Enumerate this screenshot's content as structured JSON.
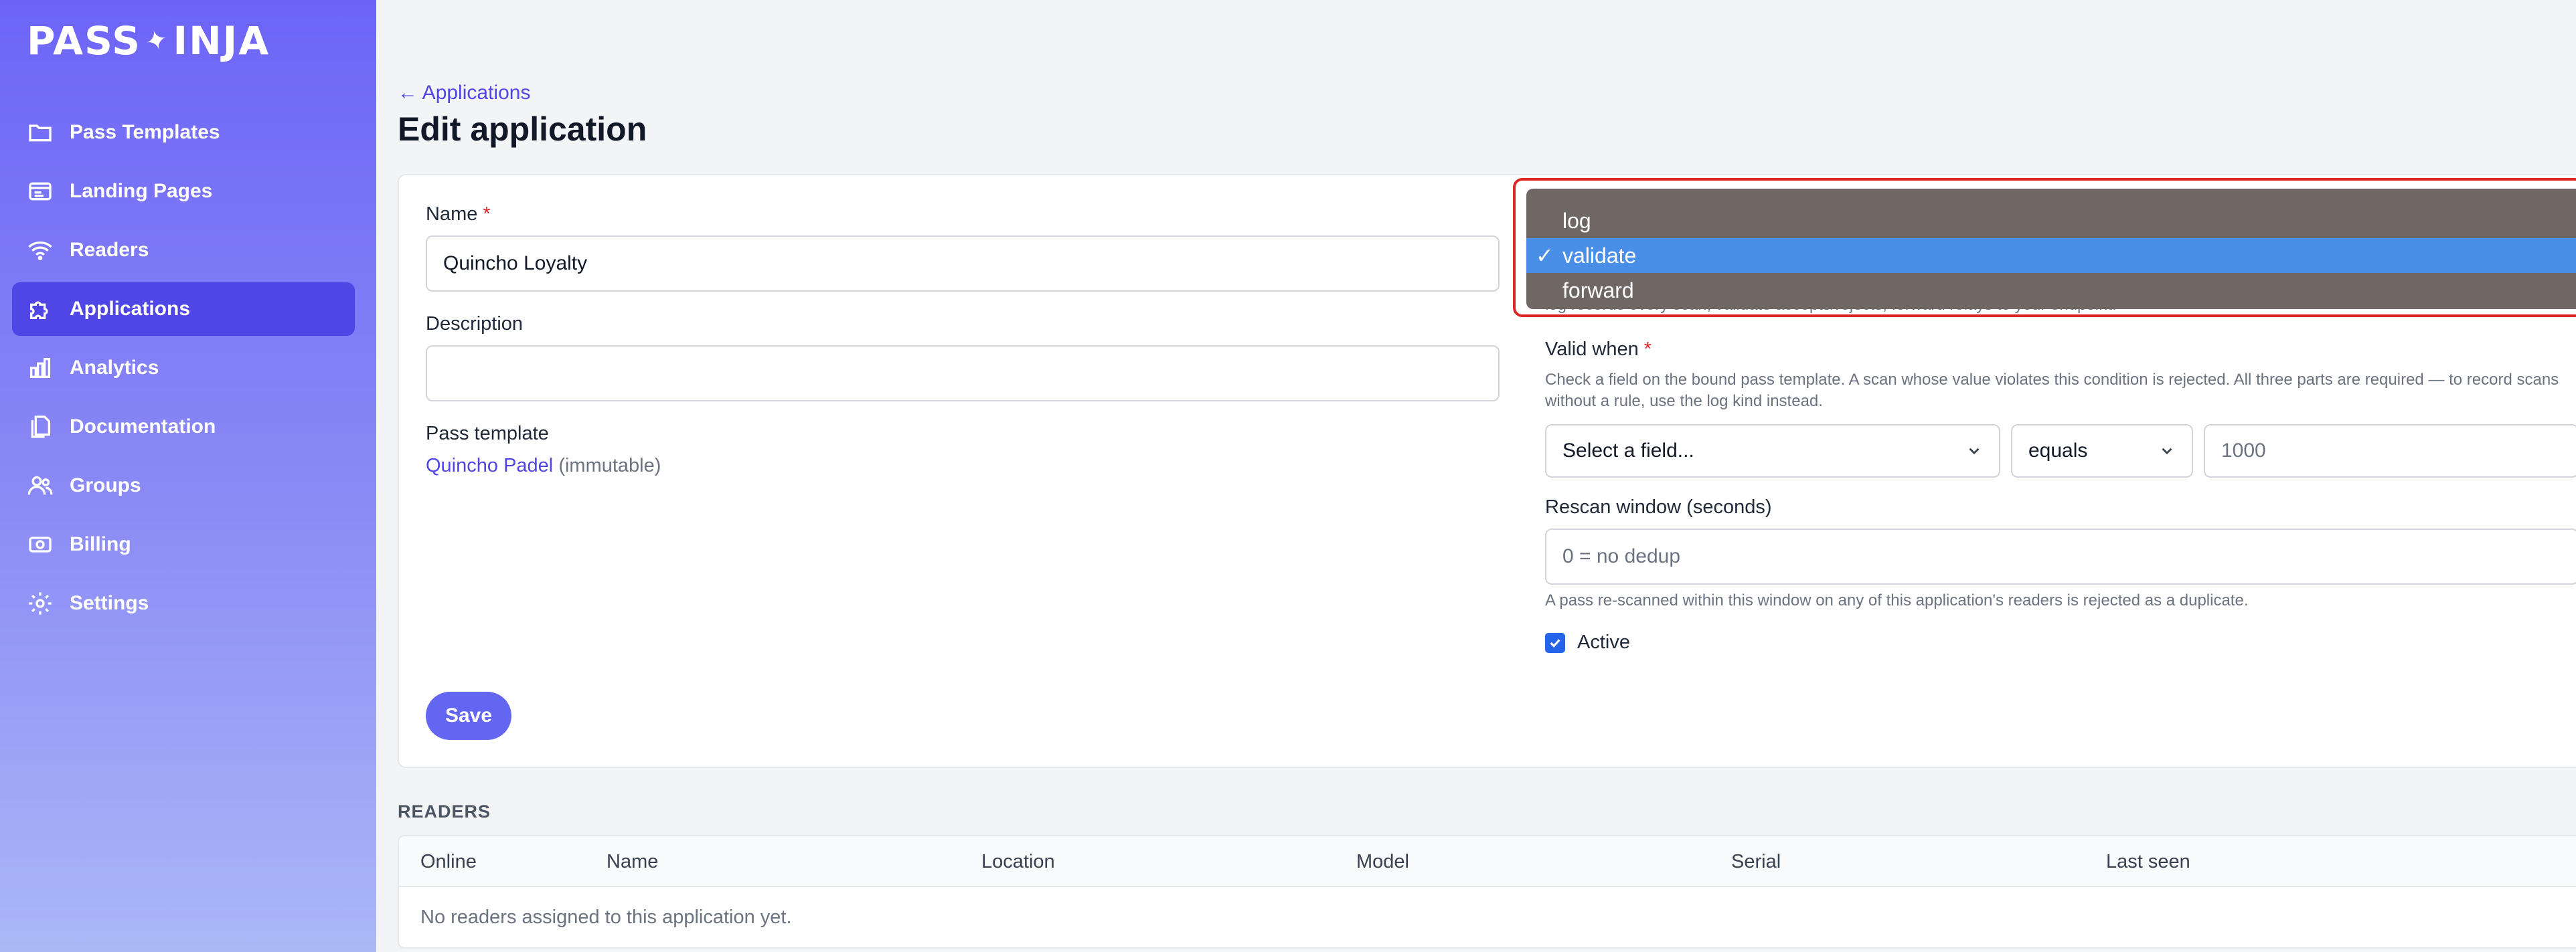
{
  "brand": {
    "logo_text_left": "PASS",
    "logo_text_right": "INJA"
  },
  "sidebar": {
    "items": [
      {
        "label": "Pass Templates",
        "icon": "folder-icon"
      },
      {
        "label": "Landing Pages",
        "icon": "browser-icon"
      },
      {
        "label": "Readers",
        "icon": "wifi-icon"
      },
      {
        "label": "Applications",
        "icon": "puzzle-icon",
        "active": true
      },
      {
        "label": "Analytics",
        "icon": "bar-chart-icon"
      },
      {
        "label": "Documentation",
        "icon": "documents-icon"
      },
      {
        "label": "Groups",
        "icon": "users-icon"
      },
      {
        "label": "Billing",
        "icon": "money-icon"
      },
      {
        "label": "Settings",
        "icon": "gear-icon"
      }
    ]
  },
  "header": {
    "back_link": "← Applications",
    "title": "Edit application"
  },
  "form": {
    "name_label": "Name",
    "required_mark": "*",
    "name_value": "Quincho Loyalty",
    "description_label": "Description",
    "description_value": "",
    "pass_template_label": "Pass template",
    "pass_template_link": "Quincho Padel",
    "pass_template_note": "(immutable)",
    "kind_help": "log records every scan; validate accepts/rejects; forward relays to your endpoint.",
    "valid_when_label": "Valid when",
    "valid_when_help": "Check a field on the bound pass template. A scan whose value violates this condition is rejected. All three parts are required — to record scans without a rule, use the log kind instead.",
    "field_select_value": "Select a field...",
    "operator_value": "equals",
    "condition_value": "1000",
    "rescan_label": "Rescan window (seconds)",
    "rescan_placeholder": "0 = no dedup",
    "rescan_help": "A pass re-scanned within this window on any of this application's readers is rejected as a duplicate.",
    "active_label": "Active",
    "active_checked": true,
    "save_label": "Save"
  },
  "kind_dropdown": {
    "options": [
      {
        "label": "log",
        "selected": false
      },
      {
        "label": "validate",
        "selected": true
      },
      {
        "label": "forward",
        "selected": false
      }
    ],
    "check_glyph": "✓"
  },
  "readers": {
    "section_title": "READERS",
    "columns": [
      "Online",
      "Name",
      "Location",
      "Model",
      "Serial",
      "Last seen"
    ],
    "empty_message": "No readers assigned to this application yet."
  },
  "colors": {
    "accent": "#6366f1",
    "sidebar_active": "#4f46e5",
    "required": "#dc2626",
    "dropdown_bg": "#6e6764",
    "dropdown_selected": "#4a8fe7"
  }
}
